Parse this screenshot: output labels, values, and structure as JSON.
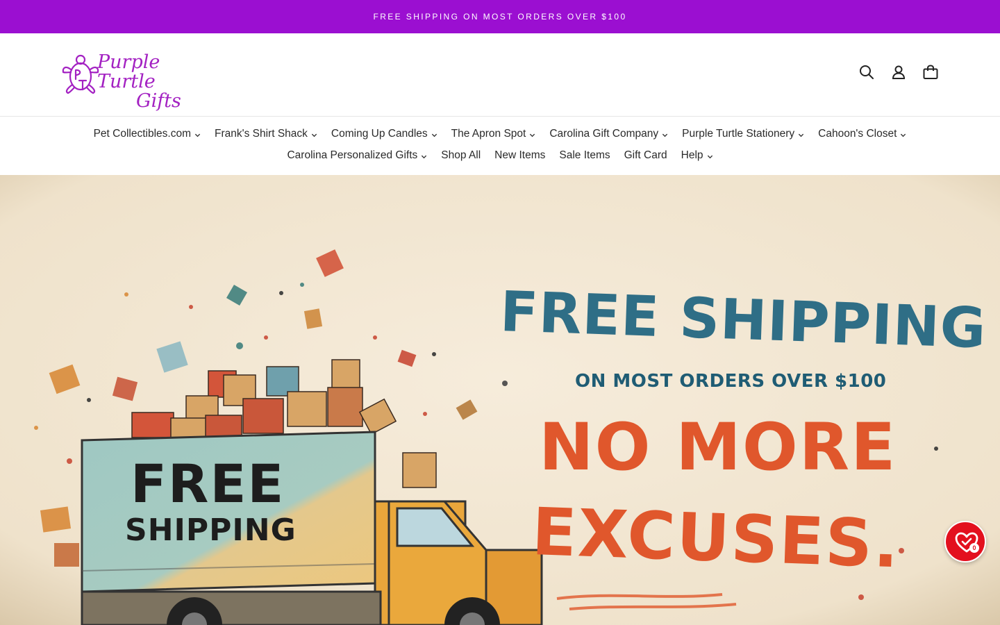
{
  "announcement": {
    "text": "FREE SHIPPING ON MOST ORDERS OVER $100"
  },
  "brand": {
    "line1": "Purple Turtle",
    "line2": "Gifts",
    "color": "#a321c2",
    "banner_color": "#9b0fd1"
  },
  "header_icons": [
    "search-icon",
    "account-icon",
    "cart-icon"
  ],
  "nav": {
    "row1": [
      {
        "label": "Pet Collectibles.com",
        "dropdown": true
      },
      {
        "label": "Frank's Shirt Shack",
        "dropdown": true
      },
      {
        "label": "Coming Up Candles",
        "dropdown": true
      },
      {
        "label": "The Apron Spot",
        "dropdown": true
      },
      {
        "label": "Carolina Gift Company",
        "dropdown": true
      },
      {
        "label": "Purple Turtle Stationery",
        "dropdown": true
      },
      {
        "label": "Cahoon's Closet",
        "dropdown": true
      }
    ],
    "row2": [
      {
        "label": "Carolina Personalized Gifts",
        "dropdown": true
      },
      {
        "label": "Shop All",
        "dropdown": false
      },
      {
        "label": "New Items",
        "dropdown": false
      },
      {
        "label": "Sale Items",
        "dropdown": false
      },
      {
        "label": "Gift Card",
        "dropdown": false
      },
      {
        "label": "Help",
        "dropdown": true
      }
    ]
  },
  "hero": {
    "headline": "FREE SHIPPING",
    "subline": "ON MOST ORDERS OVER $100",
    "tagline1": "NO MORE",
    "tagline2": "EXCUSES.",
    "truck_text1": "FREE",
    "truck_text2": "SHIPPING",
    "colors": {
      "headline": "#2f6e86",
      "tagline": "#e0572c",
      "background": "#f2e7d3"
    }
  },
  "wishlist": {
    "count": "0",
    "color": "#e3101e"
  }
}
